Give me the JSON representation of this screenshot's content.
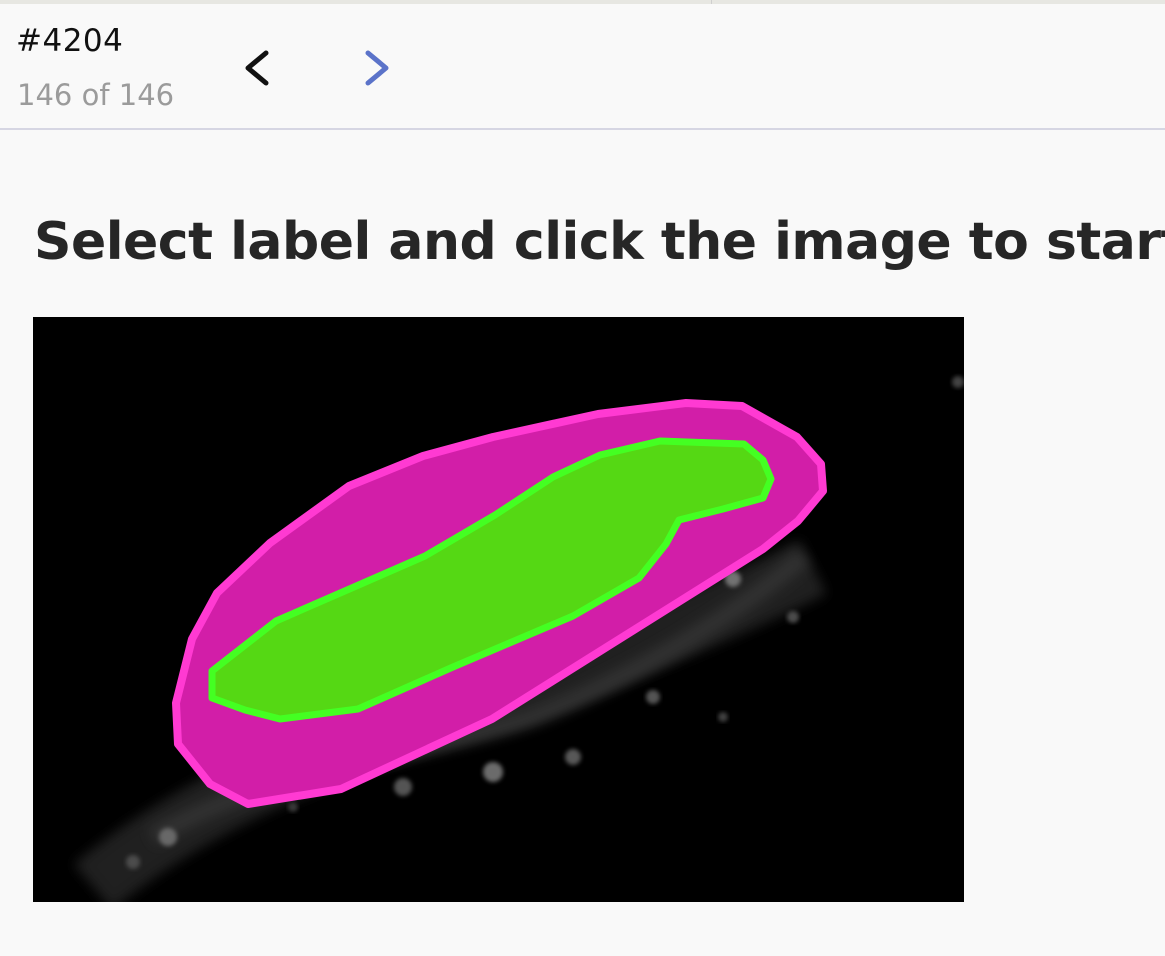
{
  "header": {
    "task_id": "#4204",
    "progress": "146 of 146",
    "current_index": 146,
    "total": 146,
    "prev_icon": "chevron-left-icon",
    "next_icon": "chevron-right-icon"
  },
  "main": {
    "instruction": "Select label and click the image to start"
  },
  "annotations": [
    {
      "label_color": "#ff3ad2",
      "fill": "#d21ea8",
      "shape": "polygon"
    },
    {
      "label_color": "#44ff22",
      "fill": "#55d814",
      "shape": "polygon"
    }
  ],
  "colors": {
    "prev_arrow": "#111111",
    "next_arrow": "#5b73c9",
    "instruction_text": "#262626",
    "count_text": "#9b9b9b"
  }
}
